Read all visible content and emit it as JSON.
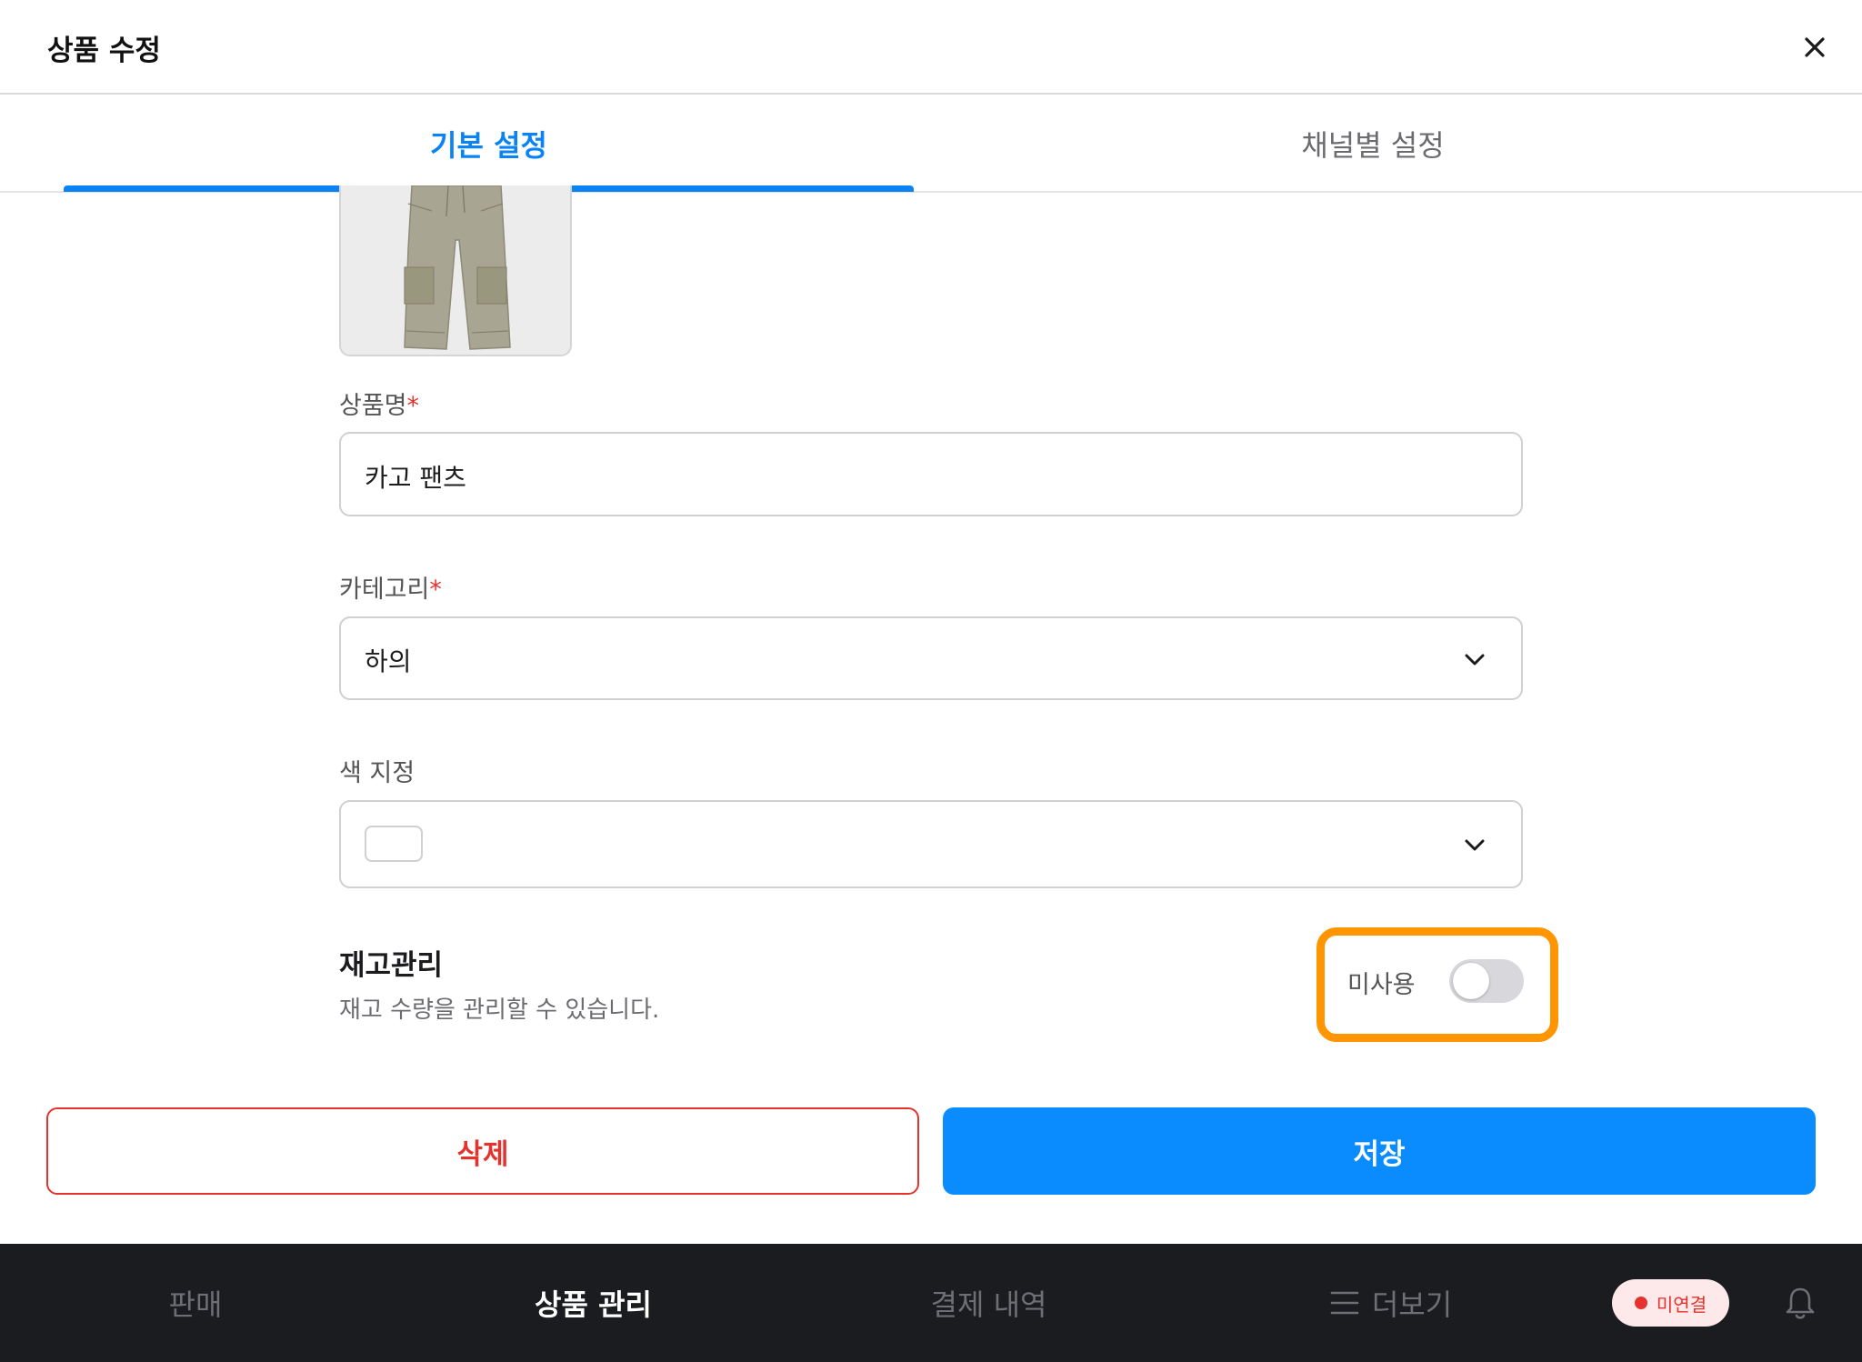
{
  "header": {
    "title": "상품 수정"
  },
  "tabs": [
    {
      "label": "기본 설정",
      "active": true
    },
    {
      "label": "채널별 설정",
      "active": false
    }
  ],
  "form": {
    "name": {
      "label": "상품명",
      "required_mark": "*",
      "value": "카고 팬츠"
    },
    "category": {
      "label": "카테고리",
      "required_mark": "*",
      "selected": "하의"
    },
    "color": {
      "label": "색 지정",
      "selected_color": "#ffffff"
    }
  },
  "inventory": {
    "title": "재고관리",
    "description": "재고 수량을 관리할 수 있습니다.",
    "toggle_label": "미사용",
    "enabled": false
  },
  "actions": {
    "delete_label": "삭제",
    "save_label": "저장"
  },
  "bottom_nav": {
    "items": [
      {
        "label": "판매",
        "active": false
      },
      {
        "label": "상품 관리",
        "active": true
      },
      {
        "label": "결제 내역",
        "active": false
      },
      {
        "label": "더보기",
        "icon": "menu-icon",
        "active": false
      }
    ],
    "status": "미연결"
  },
  "colors": {
    "accent": "#0a84f5",
    "danger": "#e5322d",
    "highlight": "#ff9500",
    "nav_bg": "#1b1c1f"
  }
}
